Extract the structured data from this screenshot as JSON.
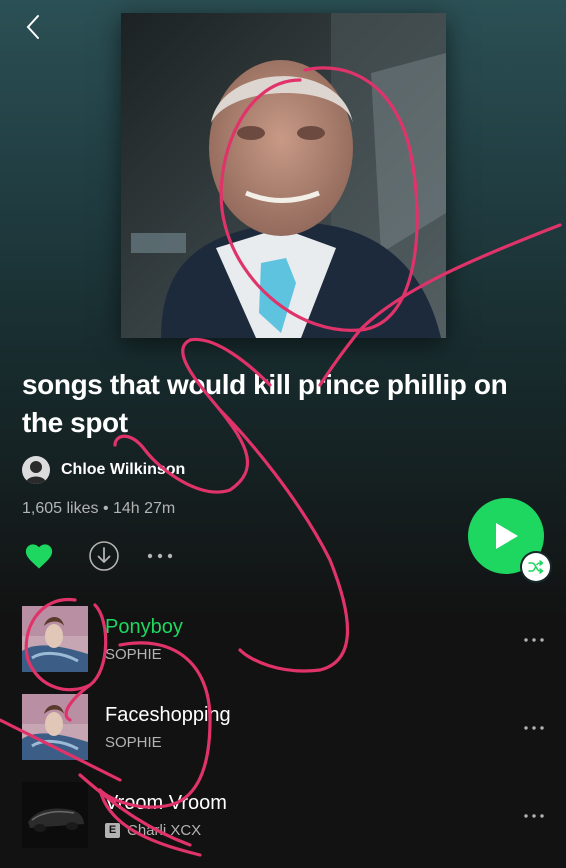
{
  "navigation": {
    "back_icon": "chevron-left-icon"
  },
  "playlist": {
    "title": "songs that would kill prince phillip on the spot",
    "owner": "Chloe Wilkinson",
    "meta": "1,605 likes • 14h 27m",
    "liked": true
  },
  "actions": {
    "like_icon": "heart-filled-icon",
    "download_icon": "download-icon",
    "more_icon": "more-horizontal-icon",
    "play_icon": "play-icon",
    "shuffle_icon": "shuffle-icon"
  },
  "tracks": [
    {
      "title": "Ponyboy",
      "artist": "SOPHIE",
      "explicit": false,
      "playing": true
    },
    {
      "title": "Faceshopping",
      "artist": "SOPHIE",
      "explicit": false,
      "playing": false
    },
    {
      "title": "Vroom Vroom",
      "artist": "Charli XCX",
      "explicit": true,
      "explicit_label": "E",
      "playing": false
    }
  ],
  "colors": {
    "accent_green": "#1ed760",
    "background": "#121212",
    "header_gradient_top": "#2b5055",
    "annotation_pink": "#e0336a",
    "secondary_text": "#b3b3b3"
  }
}
